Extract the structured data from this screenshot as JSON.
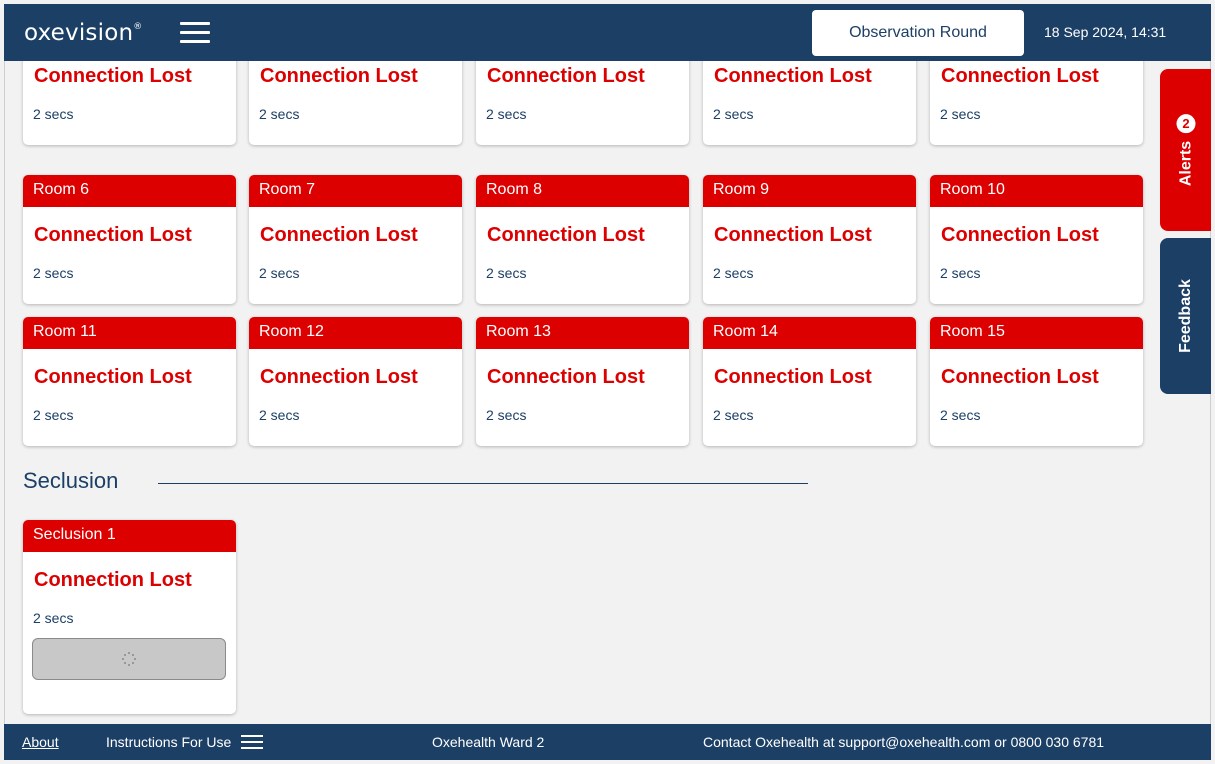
{
  "header": {
    "logo_text": "oxevision",
    "logo_mark": "®",
    "observation_button": "Observation Round",
    "datetime": "18 Sep 2024, 14:31"
  },
  "rooms": [
    {
      "name": "",
      "status": "Connection Lost",
      "time": "2 secs"
    },
    {
      "name": "",
      "status": "Connection Lost",
      "time": "2 secs"
    },
    {
      "name": "",
      "status": "Connection Lost",
      "time": "2 secs"
    },
    {
      "name": "",
      "status": "Connection Lost",
      "time": "2 secs"
    },
    {
      "name": "",
      "status": "Connection Lost",
      "time": "2 secs"
    },
    {
      "name": "Room 6",
      "status": "Connection Lost",
      "time": "2 secs"
    },
    {
      "name": "Room 7",
      "status": "Connection Lost",
      "time": "2 secs"
    },
    {
      "name": "Room 8",
      "status": "Connection Lost",
      "time": "2 secs"
    },
    {
      "name": "Room 9",
      "status": "Connection Lost",
      "time": "2 secs"
    },
    {
      "name": "Room 10",
      "status": "Connection Lost",
      "time": "2 secs"
    },
    {
      "name": "Room 11",
      "status": "Connection Lost",
      "time": "2 secs"
    },
    {
      "name": "Room 12",
      "status": "Connection Lost",
      "time": "2 secs"
    },
    {
      "name": "Room 13",
      "status": "Connection Lost",
      "time": "2 secs"
    },
    {
      "name": "Room 14",
      "status": "Connection Lost",
      "time": "2 secs"
    },
    {
      "name": "Room 15",
      "status": "Connection Lost",
      "time": "2 secs"
    }
  ],
  "seclusion": {
    "title": "Seclusion",
    "card": {
      "name": "Seclusion 1",
      "status": "Connection Lost",
      "time": "2 secs"
    }
  },
  "side_tabs": {
    "alerts_label": "Alerts",
    "alerts_count": "2",
    "feedback_label": "Feedback"
  },
  "footer": {
    "about": "About",
    "instructions": "Instructions For Use",
    "ward": "Oxehealth Ward 2",
    "contact": "Contact Oxehealth at support@oxehealth.com or 0800 030 6781"
  },
  "colors": {
    "navy": "#1c3f66",
    "alert_red": "#dd0000",
    "background": "#f2f2f2"
  }
}
